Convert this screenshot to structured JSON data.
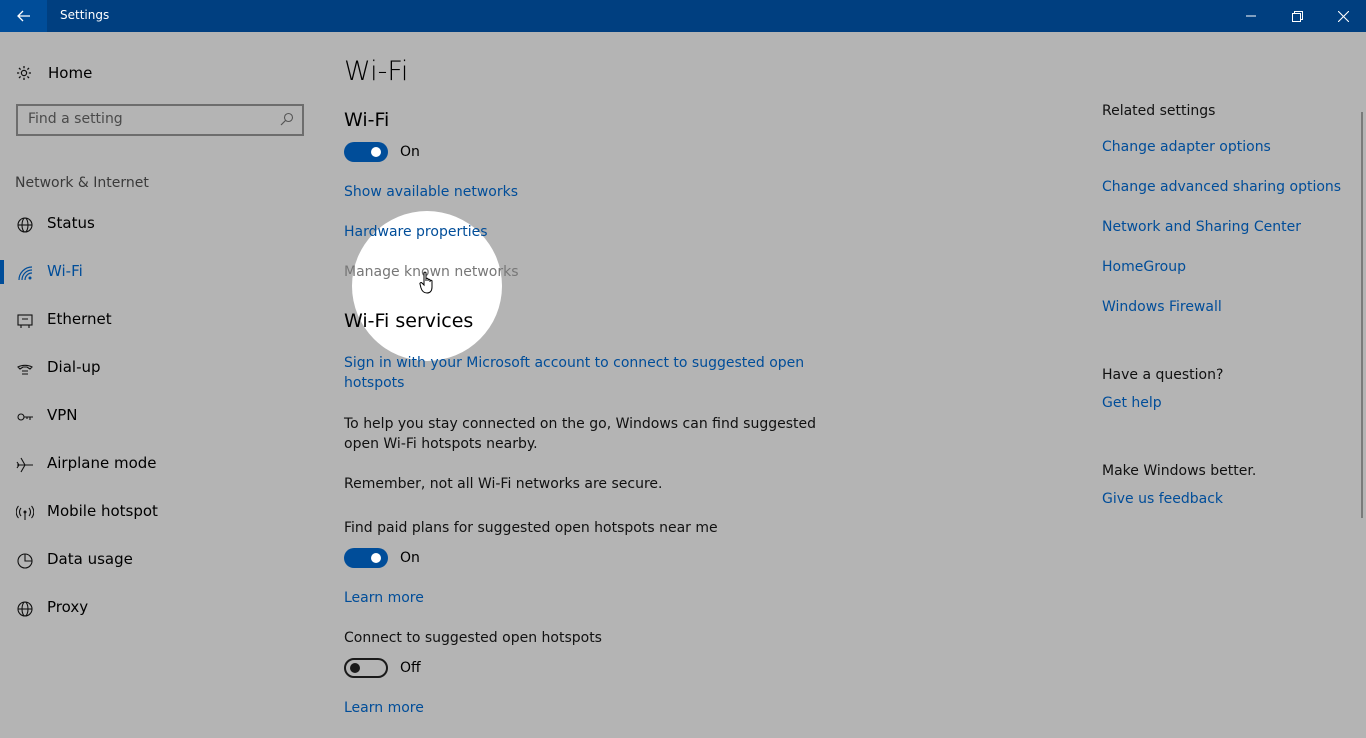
{
  "window": {
    "title": "Settings",
    "back_icon": "back-arrow-icon",
    "minimize_icon": "minimize-icon",
    "restore_icon": "restore-icon",
    "close_icon": "close-icon"
  },
  "sidebar": {
    "home_label": "Home",
    "search_placeholder": "Find a setting",
    "section_header": "Network & Internet",
    "items": [
      {
        "label": "Status",
        "icon": "globe-icon"
      },
      {
        "label": "Wi-Fi",
        "icon": "wifi-icon",
        "selected": true
      },
      {
        "label": "Ethernet",
        "icon": "ethernet-icon"
      },
      {
        "label": "Dial-up",
        "icon": "dialup-icon"
      },
      {
        "label": "VPN",
        "icon": "vpn-icon"
      },
      {
        "label": "Airplane mode",
        "icon": "airplane-icon"
      },
      {
        "label": "Mobile hotspot",
        "icon": "hotspot-icon"
      },
      {
        "label": "Data usage",
        "icon": "data-usage-icon"
      },
      {
        "label": "Proxy",
        "icon": "globe-icon"
      }
    ]
  },
  "main": {
    "page_title": "Wi-Fi",
    "wifi_heading": "Wi-Fi",
    "wifi_toggle_state": "On",
    "show_networks_link": "Show available networks",
    "hardware_link": "Hardware properties",
    "manage_networks_link": "Manage known networks",
    "services_heading": "Wi-Fi services",
    "sign_in_link_line1": "Sign in with your Microsoft account to connect to suggested open",
    "sign_in_link_line2": "hotspots",
    "help_text_line1": "To help you stay connected on the go, Windows can find suggested",
    "help_text_line2": "open Wi-Fi hotspots nearby.",
    "remember_text": "Remember, not all Wi-Fi networks are secure.",
    "paid_plans_label": "Find paid plans for suggested open hotspots near me",
    "paid_plans_state": "On",
    "learn_more_1": "Learn more",
    "connect_label": "Connect to suggested open hotspots",
    "connect_state": "Off",
    "learn_more_2": "Learn more"
  },
  "related": {
    "heading": "Related settings",
    "links": [
      "Change adapter options",
      "Change advanced sharing options",
      "Network and Sharing Center",
      "HomeGroup",
      "Windows Firewall"
    ],
    "question_heading": "Have a question?",
    "get_help": "Get help",
    "better_heading": "Make Windows better.",
    "feedback": "Give us feedback"
  },
  "colors": {
    "titlebar": "#003f80",
    "accent": "#004d99",
    "background": "#b4b4b4"
  }
}
